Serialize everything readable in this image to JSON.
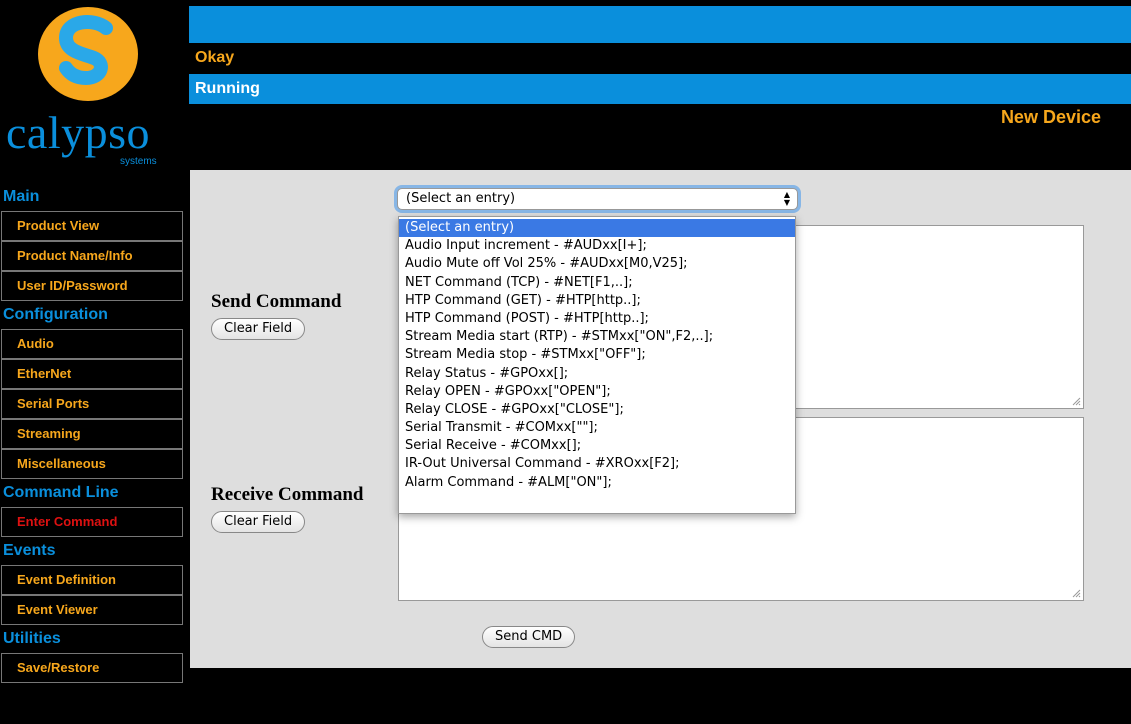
{
  "status": {
    "line1": "Okay",
    "line2": "Running",
    "device_name": "New Device"
  },
  "logo": {
    "word": "calypso",
    "sub": "systems"
  },
  "sidebar": {
    "sections": [
      {
        "label": "Main",
        "items": [
          "Product View",
          "Product Name/Info",
          "User ID/Password"
        ]
      },
      {
        "label": "Configuration",
        "items": [
          "Audio",
          "EtherNet",
          "Serial Ports",
          "Streaming",
          "Miscellaneous"
        ]
      },
      {
        "label": "Command Line",
        "items": [
          "Enter Command"
        ]
      },
      {
        "label": "Events",
        "items": [
          "Event Definition",
          "Event Viewer"
        ]
      },
      {
        "label": "Utilities",
        "items": [
          "Save/Restore"
        ]
      }
    ],
    "active_item": "Enter Command"
  },
  "main": {
    "send_label": "Send Command",
    "receive_label": "Receive Command",
    "clear_label": "Clear Field",
    "send_button": "Send CMD",
    "select_value": "(Select an entry)",
    "options": [
      "(Select an entry)",
      "Audio Input increment - #AUDxx[I+];",
      "Audio Mute off Vol 25% - #AUDxx[M0,V25];",
      "NET Command (TCP) - #NET[F1,..];",
      "HTP Command (GET) - #HTP[http..];",
      "HTP Command (POST) - #HTP[http..];",
      "Stream Media start (RTP) - #STMxx[\"ON\",F2,..];",
      "Stream Media stop - #STMxx[\"OFF\"];",
      "Relay Status - #GPOxx[];",
      "Relay OPEN - #GPOxx[\"OPEN\"];",
      "Relay CLOSE - #GPOxx[\"CLOSE\"];",
      "Serial Transmit - #COMxx[\"\"];",
      "Serial Receive - #COMxx[];",
      "IR-Out Universal Command - #XROxx[F2];",
      "Alarm Command - #ALM[\"ON\"];"
    ]
  },
  "colors": {
    "accent_blue": "#0a8fdc",
    "accent_orange": "#f7a71c",
    "active_red": "#dd1111",
    "panel": "#dedede"
  }
}
